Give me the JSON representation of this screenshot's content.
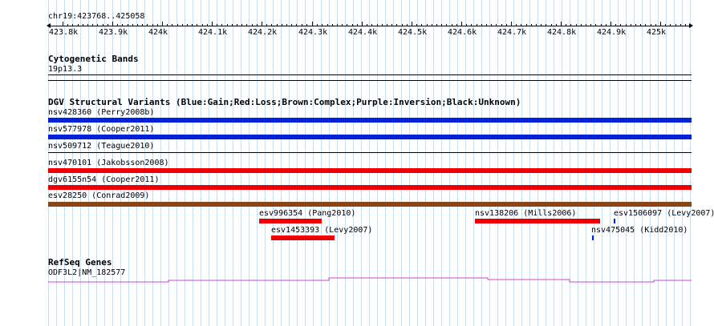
{
  "position": {
    "range": "chr19:423768..425058"
  },
  "ruler": {
    "ticks": [
      "423.8k",
      "423.9k",
      "424k",
      "424.1k",
      "424.2k",
      "424.3k",
      "424.4k",
      "424.5k",
      "424.6k",
      "424.7k",
      "424.8k",
      "424.9k",
      "425k"
    ]
  },
  "cytoband": {
    "title": "Cytogenetic Bands",
    "band": "19p13.3"
  },
  "dgv": {
    "title": "DGV Structural Variants (Blue:Gain;Red:Loss;Brown:Complex;Purple:Inversion;Black:Unknown)",
    "colors": {
      "gain": "#0022dd",
      "loss": "#ee0000",
      "complex": "#8b4513",
      "unknown": "#000000"
    },
    "rows": [
      {
        "label": "nsv428360 (Perry2008b)",
        "type": "gain"
      },
      {
        "label": "nsv577978 (Cooper2011)",
        "type": "gain"
      },
      {
        "label": "nsv509712 (Teague2010)",
        "type": "unknown"
      },
      {
        "label": "nsv470101 (Jakobsson2008)",
        "type": "loss"
      },
      {
        "label": "dgv6155n54 (Cooper2011)",
        "type": "loss"
      },
      {
        "label": "esv28250 (Conrad2009)",
        "type": "complex"
      }
    ],
    "small": [
      {
        "label": "esv996354 (Pang2010)",
        "type": "loss"
      },
      {
        "label": "nsv138206 (Mills2006)",
        "type": "loss"
      },
      {
        "label": "esv1506097 (Levy2007)",
        "type": "gain"
      },
      {
        "label": "esv1453393 (Levy2007)",
        "type": "loss"
      },
      {
        "label": "nsv475045 (Kidd2010)",
        "type": "gain"
      }
    ]
  },
  "refseq": {
    "title": "RefSeq Genes",
    "gene": "ODF3L2|NM_182577",
    "color": "#cc44cc"
  }
}
